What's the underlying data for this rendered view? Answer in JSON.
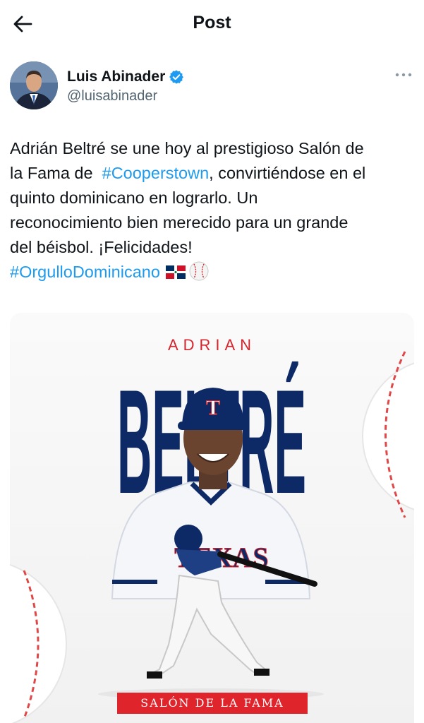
{
  "header": {
    "title": "Post"
  },
  "author": {
    "name": "Luis Abinader",
    "handle": "@luisabinader"
  },
  "tweet": {
    "line1": "Adrián Beltré se une hoy al prestigioso Salón de",
    "line2_pre": "la Fama de  ",
    "hashtag1": "#Cooperstown",
    "line2_post": ", convirtiéndose en el",
    "line3": "quinto dominicano en lograrlo. Un",
    "line4": "reconocimiento bien merecido para un grande",
    "line5": "del béisbol. ¡Felicidades!",
    "hashtag2": "#OrgulloDominicano",
    "emojis": [
      "dominican-republic-flag",
      "baseball"
    ]
  },
  "media": {
    "first_name": "ADRIAN",
    "last_name": "BELTRÉ",
    "cap_logo": "T",
    "jersey_text": "TEXAS",
    "banner": "SALÓN DE LA FAMA"
  },
  "colors": {
    "link": "#1d9bf0",
    "verified": "#1d9bf0",
    "navy": "#0d2a66",
    "red": "#e0242c"
  }
}
